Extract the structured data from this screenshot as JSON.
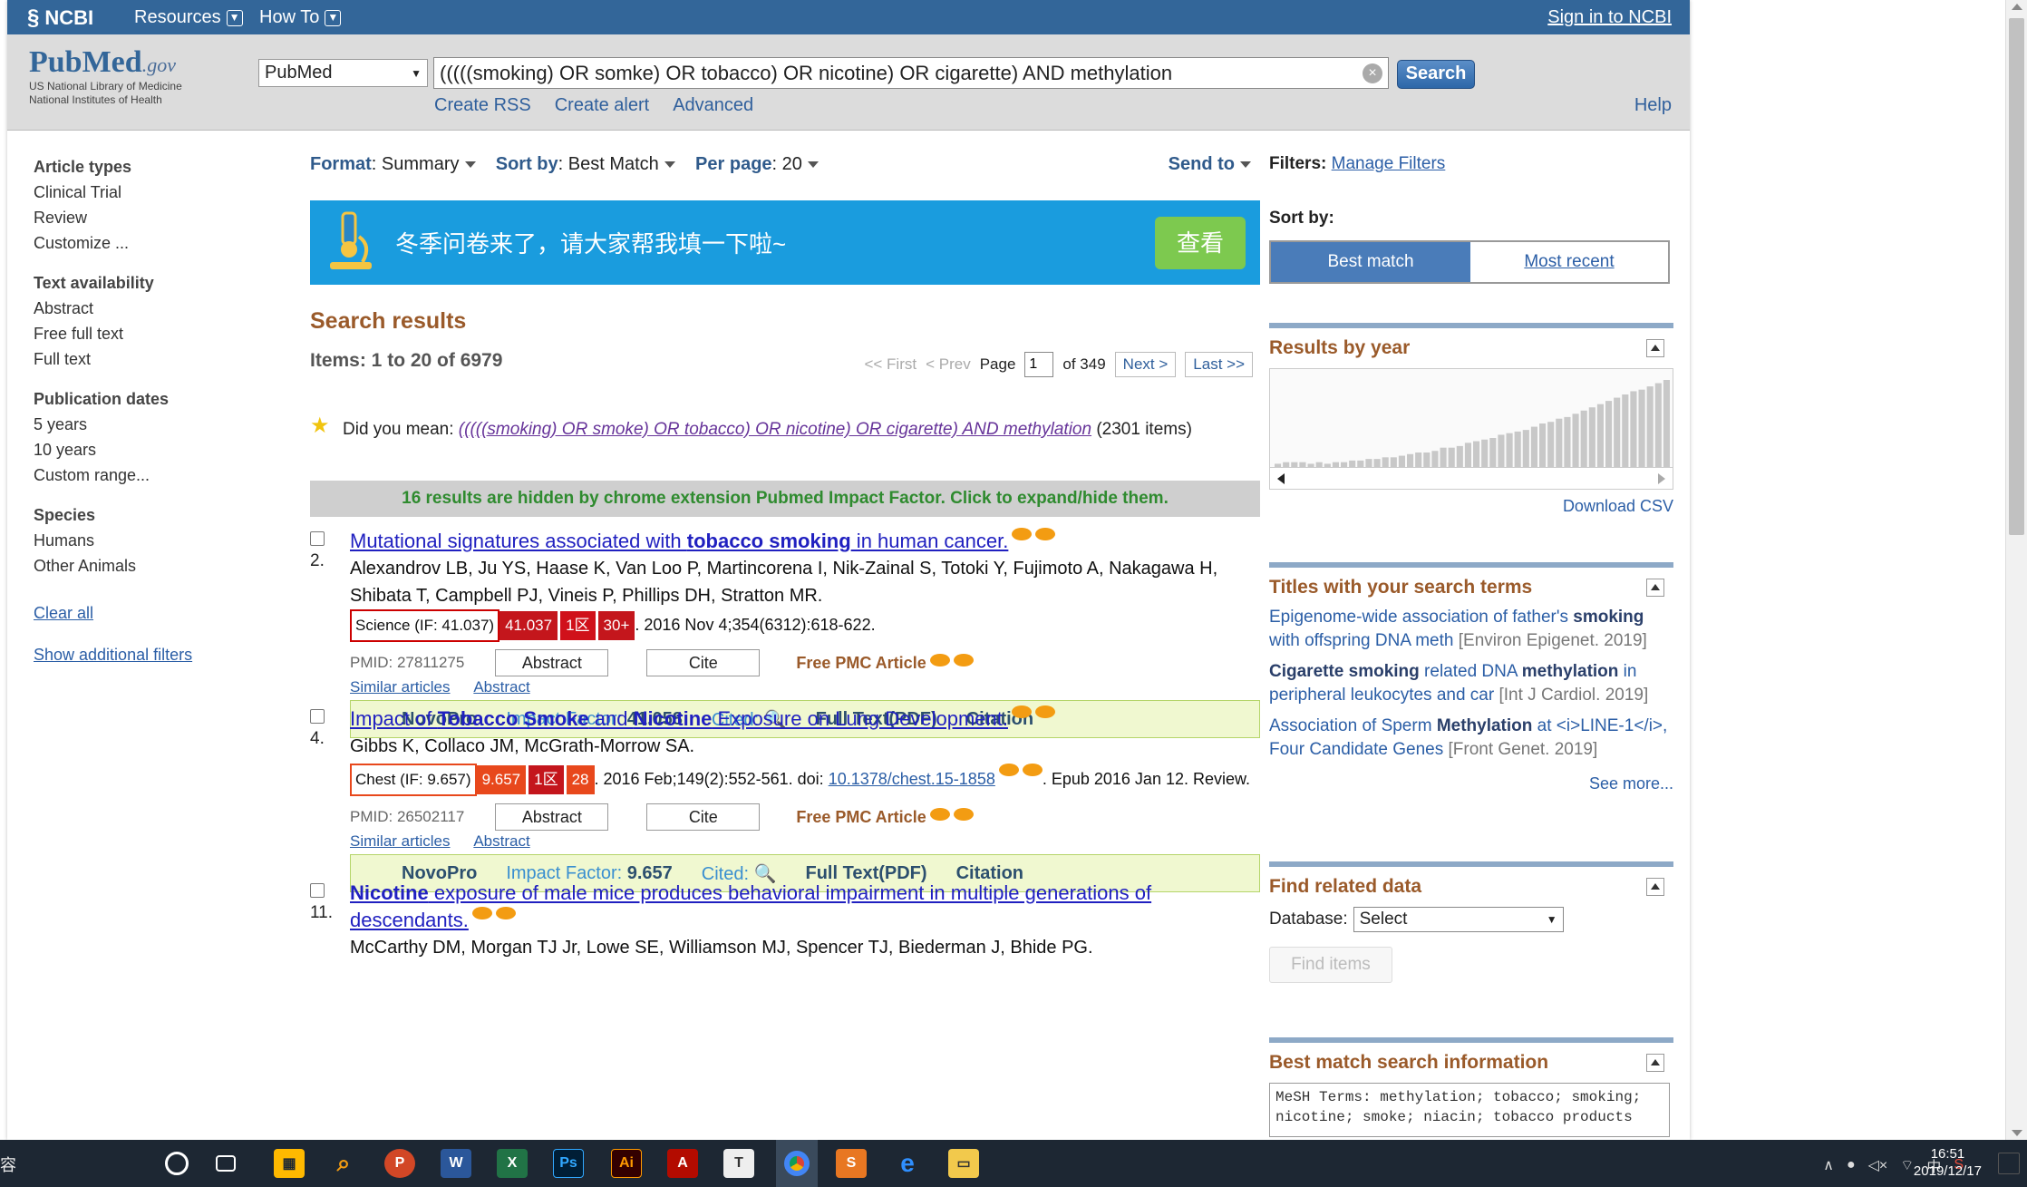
{
  "ncbi_bar": {
    "logo": "NCBI",
    "resources": "Resources",
    "howto": "How To",
    "signin": "Sign in to NCBI"
  },
  "header": {
    "logo_pub": "Pub",
    "logo_med": "Med",
    "logo_gov": ".gov",
    "logo_sub1": "US National Library of Medicine",
    "logo_sub2": "National Institutes of Health",
    "db_selected": "PubMed",
    "query": "(((((smoking) OR somke) OR tobacco) OR nicotine) OR cigarette) AND methylation",
    "search_btn": "Search",
    "links": [
      "Create RSS",
      "Create alert",
      "Advanced"
    ],
    "help": "Help"
  },
  "left_nav": {
    "groups": [
      {
        "title": "Article types",
        "items": [
          "Clinical Trial",
          "Review",
          "Customize ..."
        ]
      },
      {
        "title": "Text availability",
        "items": [
          "Abstract",
          "Free full text",
          "Full text"
        ]
      },
      {
        "title": "Publication dates",
        "items": [
          "5 years",
          "10 years",
          "Custom range..."
        ]
      },
      {
        "title": "Species",
        "items": [
          "Humans",
          "Other Animals"
        ]
      }
    ],
    "clear_all": "Clear all",
    "show_filters": "Show additional filters"
  },
  "toolbar": {
    "format_label": "Format",
    "format_value": "Summary",
    "sort_label": "Sort by",
    "sort_value": "Best Match",
    "perpage_label": "Per page",
    "perpage_value": "20",
    "send_to": "Send to"
  },
  "banner": {
    "text": "冬季问卷来了，请大家帮我填一下啦~",
    "button": "查看",
    "color": "#1a9cde"
  },
  "results": {
    "title": "Search results",
    "items_text": "Items: 1 to 20 of 6979",
    "pager": {
      "first": "<< First",
      "prev": "< Prev",
      "page_label": "Page",
      "page": "1",
      "of": "of 349",
      "next": "Next >",
      "last": "Last >>"
    },
    "did_you_mean_label": "Did you mean:",
    "did_you_mean_query": "(((((smoking) OR smoke) OR tobacco) OR nicotine) OR cigarette) AND methylation",
    "did_you_mean_count": "(2301 items)",
    "hidden_notice": "16 results are hidden by chrome extension Pubmed Impact Factor. Click to expand/hide them."
  },
  "articles": [
    {
      "num": "2.",
      "title_parts": [
        "Mutational signatures associated with ",
        "tobacco smoking",
        " in human cancer."
      ],
      "authors": "Alexandrov LB, Ju YS, Haase K, Van Loo P, Martincorena I, Nik-Zainal S, Totoki Y, Fujimoto A, Nakagawa H, Shibata T, Campbell PJ, Vineis P, Phillips DH, Stratton MR.",
      "journal": "Science (IF: 41.037)",
      "if": "41.037",
      "zone": "1区",
      "cited": "30+",
      "citation": ". 2016 Nov 4;354(6312):618-622.",
      "pmid": "PMID: 27811275",
      "abstract_btn": "Abstract",
      "cite_btn": "Cite",
      "free": "Free PMC Article",
      "similar": "Similar articles",
      "abstract_link": "Abstract",
      "novo": "NovoPro",
      "if_label": "Impact Factor:",
      "if_value": "41.058",
      "cited_label": "Cited:",
      "fulltext": "Full Text(PDF)",
      "citation_link": "Citation"
    },
    {
      "num": "4.",
      "title_parts": [
        "Impact of ",
        "Tobacco Smoke",
        " and ",
        "Nicotine",
        " Exposure on Lung Development."
      ],
      "authors": "Gibbs K, Collaco JM, McGrath-Morrow SA.",
      "journal": "Chest (IF: 9.657)",
      "if": "9.657",
      "zone": "1区",
      "cited": "28",
      "citation": ". 2016 Feb;149(2):552-561. doi: ",
      "doi": "10.1378/chest.15-1858",
      "citation2": ". Epub 2016 Jan 12. Review.",
      "pmid": "PMID: 26502117",
      "abstract_btn": "Abstract",
      "cite_btn": "Cite",
      "free": "Free PMC Article",
      "similar": "Similar articles",
      "abstract_link": "Abstract",
      "novo": "NovoPro",
      "if_label": "Impact Factor:",
      "if_value": "9.657",
      "cited_label": "Cited:",
      "fulltext": "Full Text(PDF)",
      "citation_link": "Citation"
    },
    {
      "num": "11.",
      "title_parts": [
        "Nicotine",
        " exposure of male mice produces behavioral impairment in multiple generations of descendants."
      ],
      "authors": "McCarthy DM, Morgan TJ Jr, Lowe SE, Williamson MJ, Spencer TJ, Biederman J, Bhide PG."
    }
  ],
  "right": {
    "filters_label": "Filters:",
    "manage_filters": "Manage Filters",
    "sortby_label": "Sort by:",
    "best_match": "Best match",
    "most_recent": "Most recent",
    "results_by_year": "Results by year",
    "year_bars": [
      2,
      3,
      3,
      3,
      2,
      3,
      2,
      3,
      3,
      4,
      4,
      5,
      5,
      6,
      6,
      7,
      8,
      9,
      9,
      10,
      12,
      12,
      13,
      15,
      16,
      17,
      18,
      20,
      21,
      22,
      23,
      25,
      27,
      28,
      30,
      31,
      33,
      35,
      37,
      39,
      41,
      43,
      45,
      47,
      48,
      50,
      52,
      54
    ],
    "download_csv": "Download CSV",
    "titles_head": "Titles with your search terms",
    "titles": [
      {
        "pre": "Epigenome-wide association of father's ",
        "bold": "smoking",
        "post": " with offspring DNA meth",
        "src": "[Environ Epigenet. 2019]"
      },
      {
        "pre": "",
        "bold": "Cigarette smoking",
        "mid": " related DNA ",
        "bold2": "methylation",
        "post": " in peripheral leukocytes and car",
        "src": "[Int J Cardiol. 2019]"
      },
      {
        "pre": "Association of Sperm ",
        "bold": "Methylation",
        "post": " at <i>LINE-1</i>, Four Candidate Genes",
        "src": "[Front Genet. 2019]"
      }
    ],
    "see_more": "See more...",
    "related_head": "Find related data",
    "database_label": "Database:",
    "database_value": "Select",
    "find_items": "Find items",
    "bestmatch_head": "Best match search information",
    "mesh": "MeSH Terms: methylation; tobacco; smoking; nicotine; smoke; niacin; tobacco products"
  },
  "taskbar": {
    "left_text": "容",
    "time": "16:51",
    "date": "2019/12/17",
    "ime": "中"
  }
}
